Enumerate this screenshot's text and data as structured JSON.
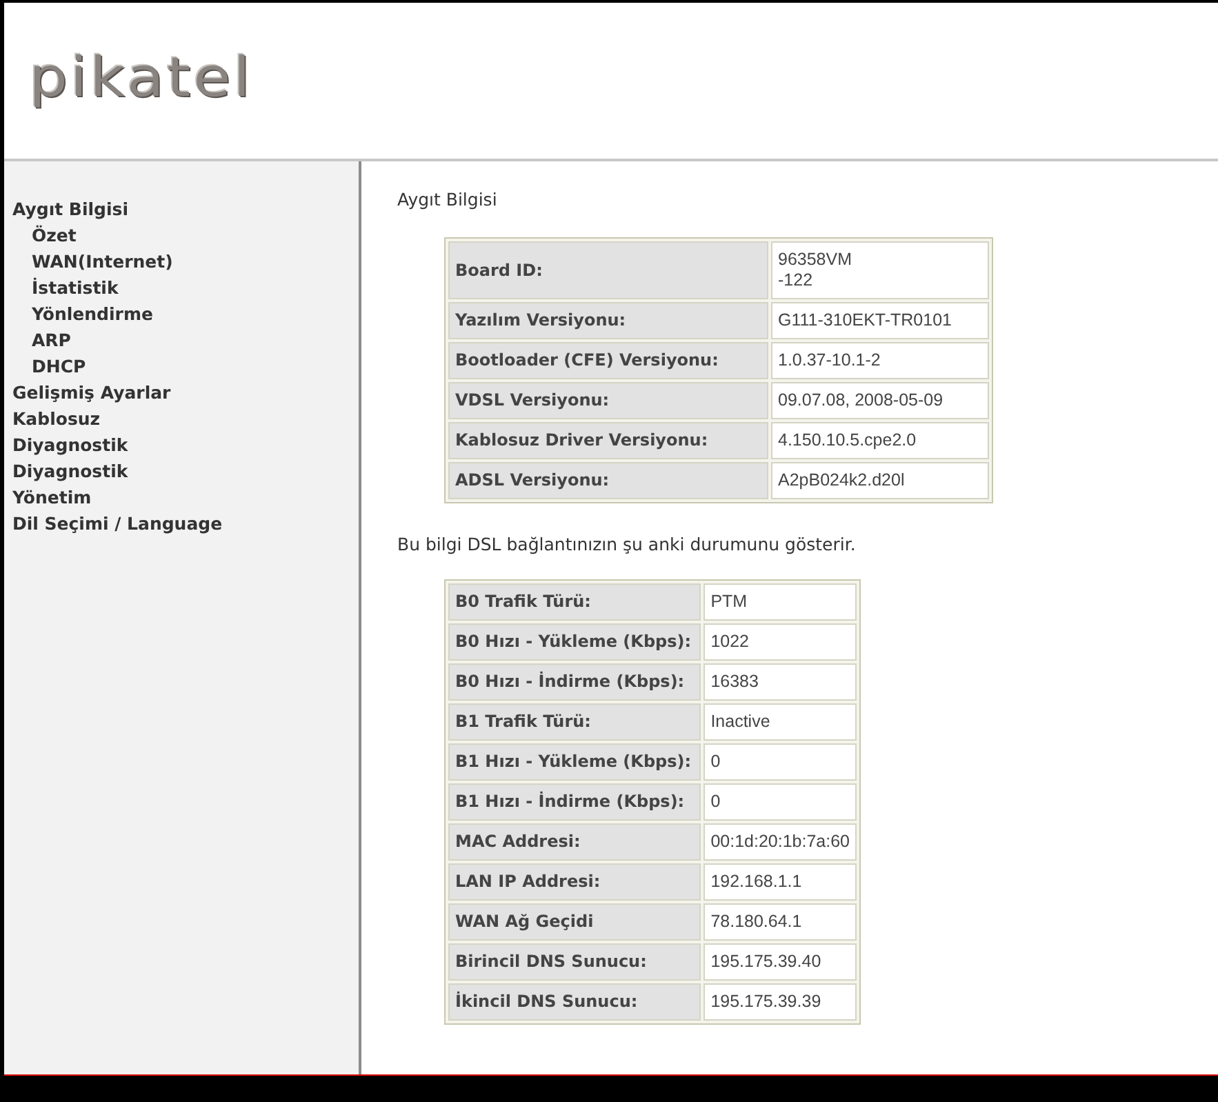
{
  "logo": "pikatel",
  "sidebar": {
    "items": [
      {
        "label": "Aygıt Bilgisi",
        "children": [
          {
            "label": "Özet"
          },
          {
            "label": "WAN(Internet)"
          },
          {
            "label": "İstatistik"
          },
          {
            "label": "Yönlendirme"
          },
          {
            "label": "ARP"
          },
          {
            "label": "DHCP"
          }
        ]
      },
      {
        "label": "Gelişmiş Ayarlar"
      },
      {
        "label": "Kablosuz"
      },
      {
        "label": "Diyagnostik"
      },
      {
        "label": "Diyagnostik"
      },
      {
        "label": "Yönetim"
      },
      {
        "label": "Dil Seçimi / Language"
      }
    ]
  },
  "content": {
    "title": "Aygıt Bilgisi",
    "device_table": {
      "rows": [
        {
          "label": "Board ID:",
          "value": "96358VM\n-122"
        },
        {
          "label": "Yazılım Versiyonu:",
          "value": "G111-310EKT-TR0101"
        },
        {
          "label": "Bootloader (CFE) Versiyonu:",
          "value": "1.0.37-10.1-2"
        },
        {
          "label": "VDSL Versiyonu:",
          "value": "09.07.08, 2008-05-09"
        },
        {
          "label": "Kablosuz Driver Versiyonu:",
          "value": "4.150.10.5.cpe2.0"
        },
        {
          "label": "ADSL Versiyonu:",
          "value": "A2pB024k2.d20l"
        }
      ]
    },
    "note": "Bu bilgi DSL bağlantınızın şu anki durumunu gösterir.",
    "dsl_table": {
      "rows": [
        {
          "label": "B0 Trafik Türü:",
          "value": "PTM"
        },
        {
          "label": "B0 Hızı - Yükleme (Kbps):",
          "value": "1022"
        },
        {
          "label": "B0 Hızı - İndirme (Kbps):",
          "value": "16383"
        },
        {
          "label": "B1 Trafik Türü:",
          "value": "Inactive"
        },
        {
          "label": "B1 Hızı - Yükleme (Kbps):",
          "value": "0"
        },
        {
          "label": "B1 Hızı - İndirme (Kbps):",
          "value": "0"
        },
        {
          "label": "MAC Addresi:",
          "value": "00:1d:20:1b:7a:60"
        },
        {
          "label": "LAN IP Addresi:",
          "value": "192.168.1.1"
        },
        {
          "label": "WAN Ağ Geçidi",
          "value": "78.180.64.1"
        },
        {
          "label": "Birincil DNS Sunucu:",
          "value": "195.175.39.40"
        },
        {
          "label": "İkincil DNS Sunucu:",
          "value": "195.175.39.39"
        }
      ]
    }
  }
}
